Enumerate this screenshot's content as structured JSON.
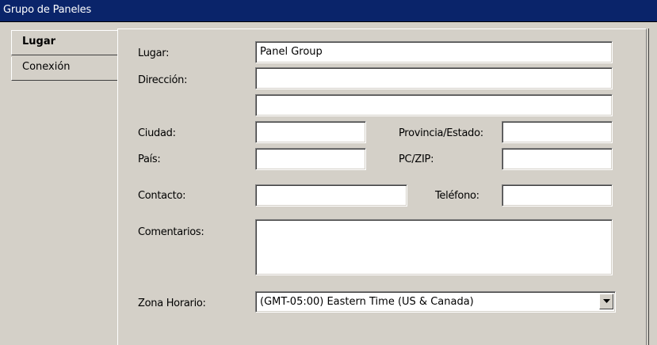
{
  "window": {
    "title": "Grupo de Paneles"
  },
  "tabs": [
    {
      "label": "Lugar",
      "active": true
    },
    {
      "label": "Conexión",
      "active": false
    }
  ],
  "form": {
    "lugar": {
      "label": "Lugar:",
      "value": "Panel Group"
    },
    "direccion": {
      "label": "Dirección:",
      "line1": "",
      "line2": ""
    },
    "ciudad": {
      "label": "Ciudad:",
      "value": ""
    },
    "provincia": {
      "label": "Provincia/Estado:",
      "value": ""
    },
    "pais": {
      "label": "País:",
      "value": ""
    },
    "zip": {
      "label": "PC/ZIP:",
      "value": ""
    },
    "contacto": {
      "label": "Contacto:",
      "value": ""
    },
    "telefono": {
      "label": "Teléfono:",
      "value": ""
    },
    "comentarios": {
      "label": "Comentarios:",
      "value": ""
    },
    "zona": {
      "label": "Zona Horario:",
      "value": "(GMT-05:00) Eastern Time (US & Canada)"
    }
  },
  "icons": {
    "dropdown": "chevron-down-icon"
  },
  "colors": {
    "titlebar": "#0a246a",
    "face": "#d4d0c8",
    "field": "#ffffff"
  }
}
